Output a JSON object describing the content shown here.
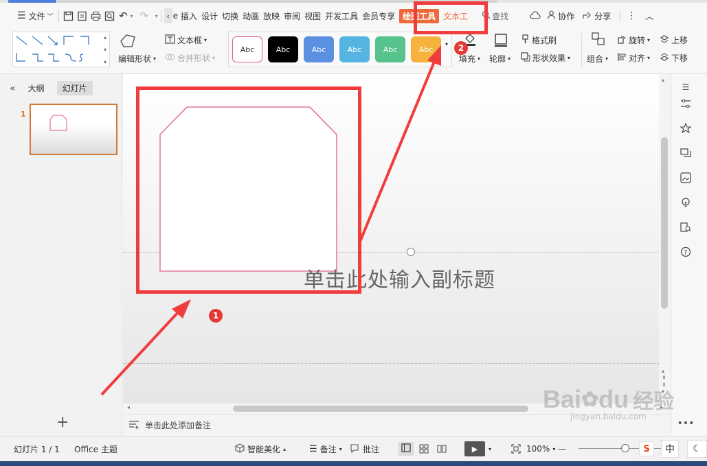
{
  "menubar": {
    "file_label": "文件",
    "tabs": [
      "插入",
      "设计",
      "切换",
      "动画",
      "放映",
      "审阅",
      "视图",
      "开发工具",
      "会员专享"
    ],
    "tabs_prefix": "e",
    "active_tab": "绘图工具",
    "next_tab": "文本工具",
    "search_label": "查找",
    "collab_label": "协作",
    "share_label": "分享"
  },
  "ribbon": {
    "edit_shape": "编辑形状",
    "textbox": "文本框",
    "merge_shape": "合并形状",
    "styles": [
      {
        "label": "Abc",
        "bg": "#ffffff",
        "fg": "#333333",
        "border": "#e06080"
      },
      {
        "label": "Abc",
        "bg": "#000000",
        "fg": "#ffffff",
        "border": "#000000"
      },
      {
        "label": "Abc",
        "bg": "#5b8fe0",
        "fg": "#ffffff",
        "border": "#5b8fe0"
      },
      {
        "label": "Abc",
        "bg": "#56b4e3",
        "fg": "#ffffff",
        "border": "#56b4e3"
      },
      {
        "label": "Abc",
        "bg": "#57c28c",
        "fg": "#ffffff",
        "border": "#57c28c"
      },
      {
        "label": "Abc",
        "bg": "#f5b23c",
        "fg": "#ffffff",
        "border": "#f5b23c"
      }
    ],
    "fill": "填充",
    "outline": "轮廓",
    "format_painter": "格式刷",
    "shape_effect": "形状效果",
    "group": "组合",
    "rotate": "旋转",
    "align": "对齐",
    "move_up": "上移",
    "move_down": "下移"
  },
  "leftpane": {
    "outline_tab": "大纲",
    "slides_tab": "幻灯片",
    "slide_number": "1"
  },
  "canvas": {
    "subtitle_placeholder": "单击此处输入副标题"
  },
  "notes": {
    "placeholder": "单击此处添加备注"
  },
  "statusbar": {
    "slide_count": "幻灯片 1 / 1",
    "theme": "Office 主题",
    "smart_beautify": "智能美化",
    "notes": "备注",
    "comment": "批注",
    "zoom": "100%",
    "ime_label": "中"
  },
  "annotations": {
    "badge1": "1",
    "badge2": "2"
  },
  "watermark": {
    "brand": "Bai",
    "brand2": "du",
    "brand_cn": "经验",
    "url": "jingyan.baidu.com"
  },
  "colors": {
    "accent": "#ef6a3a",
    "annotation": "#f03c3c",
    "shape_outline": "#e06080"
  }
}
